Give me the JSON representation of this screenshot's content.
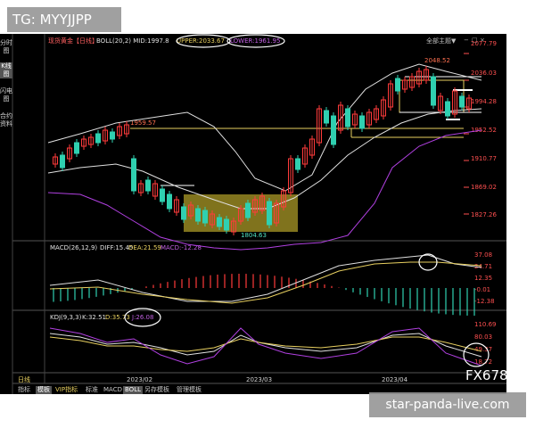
{
  "watermarks": {
    "tg": "TG: MYYJJPP",
    "site": "star-panda-live.com",
    "fx": "FX678"
  },
  "sidebar": {
    "items": [
      {
        "label": "分时图"
      },
      {
        "label": "K线图"
      },
      {
        "label": "闪电图"
      },
      {
        "label": "合约资料"
      }
    ]
  },
  "header": {
    "instrument": "现货黄金【日线】",
    "boll": "BOLL(20,2) MID:1997.8",
    "upper": "UPPER:2033.67",
    "lower": "LOWER:1961.95",
    "toolbar": "全部主题▼"
  },
  "price_axis": [
    "2077.79",
    "2036.03",
    "1994.28",
    "1952.52",
    "1910.77",
    "1869.02",
    "1827.26"
  ],
  "annotations": {
    "high1": "1959.57",
    "high2": "2048.52",
    "low": "1804.63"
  },
  "macd": {
    "label": "MACD(26,12,9)",
    "diff": "DIFF:15.45",
    "dea": "DEA:21.59",
    "macd": "MACD:-12.28",
    "axis": [
      "37.08",
      "24.71",
      "12.35",
      "-0.01",
      "-12.38"
    ]
  },
  "kdj": {
    "label": "KDJ(9,3,3)",
    "k": "K:32.51",
    "d": "D:35.73",
    "j": "J:26.08",
    "axis": [
      "110.69",
      "80.03",
      "49.37",
      "18.72"
    ]
  },
  "time_axis": {
    "label": "日线",
    "dates": [
      "2023/02",
      "2023/03",
      "2023/04"
    ]
  },
  "tabs": [
    {
      "label": "指标"
    },
    {
      "label": "模板"
    },
    {
      "label": "VIP指标"
    },
    {
      "label": "标准"
    },
    {
      "label": "MACD"
    },
    {
      "label": "BOLL"
    },
    {
      "label": "另存模板"
    },
    {
      "label": "管理模板"
    }
  ],
  "colors": {
    "up": "#ff3b3b",
    "down": "#2fd0b0",
    "boll_mid": "#e0e0e0",
    "boll_band": "#e0e0e0",
    "lower_band": "#b040e0",
    "accent_yellow": "#e8d060",
    "axis_text": "#ff5050",
    "zone": "#b7a42a"
  }
}
